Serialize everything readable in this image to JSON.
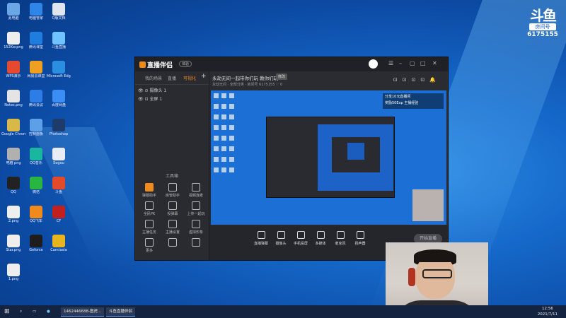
{
  "colors": {
    "accent": "#f08a1c",
    "desktop": "#1568c9",
    "window_bg": "#2a2b31"
  },
  "desktop": {
    "icons": [
      {
        "label": "此电脑",
        "c": "#6ba6e6"
      },
      {
        "label": "电脑管家",
        "c": "#2f86e8"
      },
      {
        "label": "Q版文档",
        "c": "#dfe6f0"
      },
      {
        "label": "152Kw.png",
        "c": "#eee"
      },
      {
        "label": "腾讯课堂",
        "c": "#1f7de0"
      },
      {
        "label": "斗鱼直播",
        "c": "#6fc3ff"
      },
      {
        "label": "WPS演示",
        "c": "#e64a2e"
      },
      {
        "label": "网易云课堂",
        "c": "#f0a020"
      },
      {
        "label": "Microsoft Edge",
        "c": "#2a8fe0"
      },
      {
        "label": "Notes.png",
        "c": "#e4e4e4"
      },
      {
        "label": "腾讯会议",
        "c": "#2c7de8"
      },
      {
        "label": "百度网盘",
        "c": "#3a8ef6"
      },
      {
        "label": "Google Chrome",
        "c": "#d9b84a"
      },
      {
        "label": "控制面板",
        "c": "#5ea0e8"
      },
      {
        "label": "Photoshop",
        "c": "#1d3b6b"
      },
      {
        "label": "电脑 png",
        "c": "#b0b0b0"
      },
      {
        "label": "QQ音乐",
        "c": "#19b6a0"
      },
      {
        "label": "Sogou",
        "c": "#e8ecf4"
      },
      {
        "label": "QQ",
        "c": "#222"
      },
      {
        "label": "微信",
        "c": "#29b541"
      },
      {
        "label": "斗鱼",
        "c": "#e24a2a"
      },
      {
        "label": "2.png",
        "c": "#eee"
      },
      {
        "label": "QQ飞车",
        "c": "#f08a1c"
      },
      {
        "label": "CF",
        "c": "#c21f1f"
      },
      {
        "label": "Star.png",
        "c": "#eee"
      },
      {
        "label": "Geforce",
        "c": "#1d1d1d"
      },
      {
        "label": "Camtasia",
        "c": "#e6b520"
      },
      {
        "label": "1.png",
        "c": "#eee"
      }
    ]
  },
  "watermark": {
    "logo": "斗鱼",
    "tag": "房间号",
    "room": "6175155"
  },
  "window": {
    "brand": "直播伴侣",
    "beta": "体验",
    "tabs": [
      "我的场景",
      "直播",
      "可视化"
    ],
    "layers": [
      "摄像头 1",
      "全屏 1"
    ],
    "add_label": "添加",
    "tools_title": "工具箱",
    "tools": [
      {
        "label": "弹幕助手",
        "on": true
      },
      {
        "label": "房管助手"
      },
      {
        "label": "视频连麦"
      },
      {
        "label": "全民PK"
      },
      {
        "label": "投弹幕"
      },
      {
        "label": "上传一起玩"
      },
      {
        "label": "主播任务"
      },
      {
        "label": "主播设置"
      },
      {
        "label": "虚拟形象"
      },
      {
        "label": "更多"
      },
      {
        "label": ""
      },
      {
        "label": ""
      }
    ],
    "live_title": "永劫无间一起带你们玩 教你们玩",
    "live_badge": "修改",
    "live_sub": "永劫无间 · 全部分类 · 房间号  6175155   ♡ 0",
    "preview_info": [
      "分享10元直播间",
      "奖励50Exp 主播经验"
    ],
    "bottom_items": [
      "直播弹幕",
      "摄像头",
      "手机投屏",
      "多媒体",
      "麦克风",
      "扬声器"
    ],
    "golive": "开始直播"
  },
  "taskbar": {
    "apps": [
      "1462446688-图虎...",
      "斗鱼直播伴侣"
    ],
    "time": "12:56",
    "date": "2021/7/11"
  }
}
